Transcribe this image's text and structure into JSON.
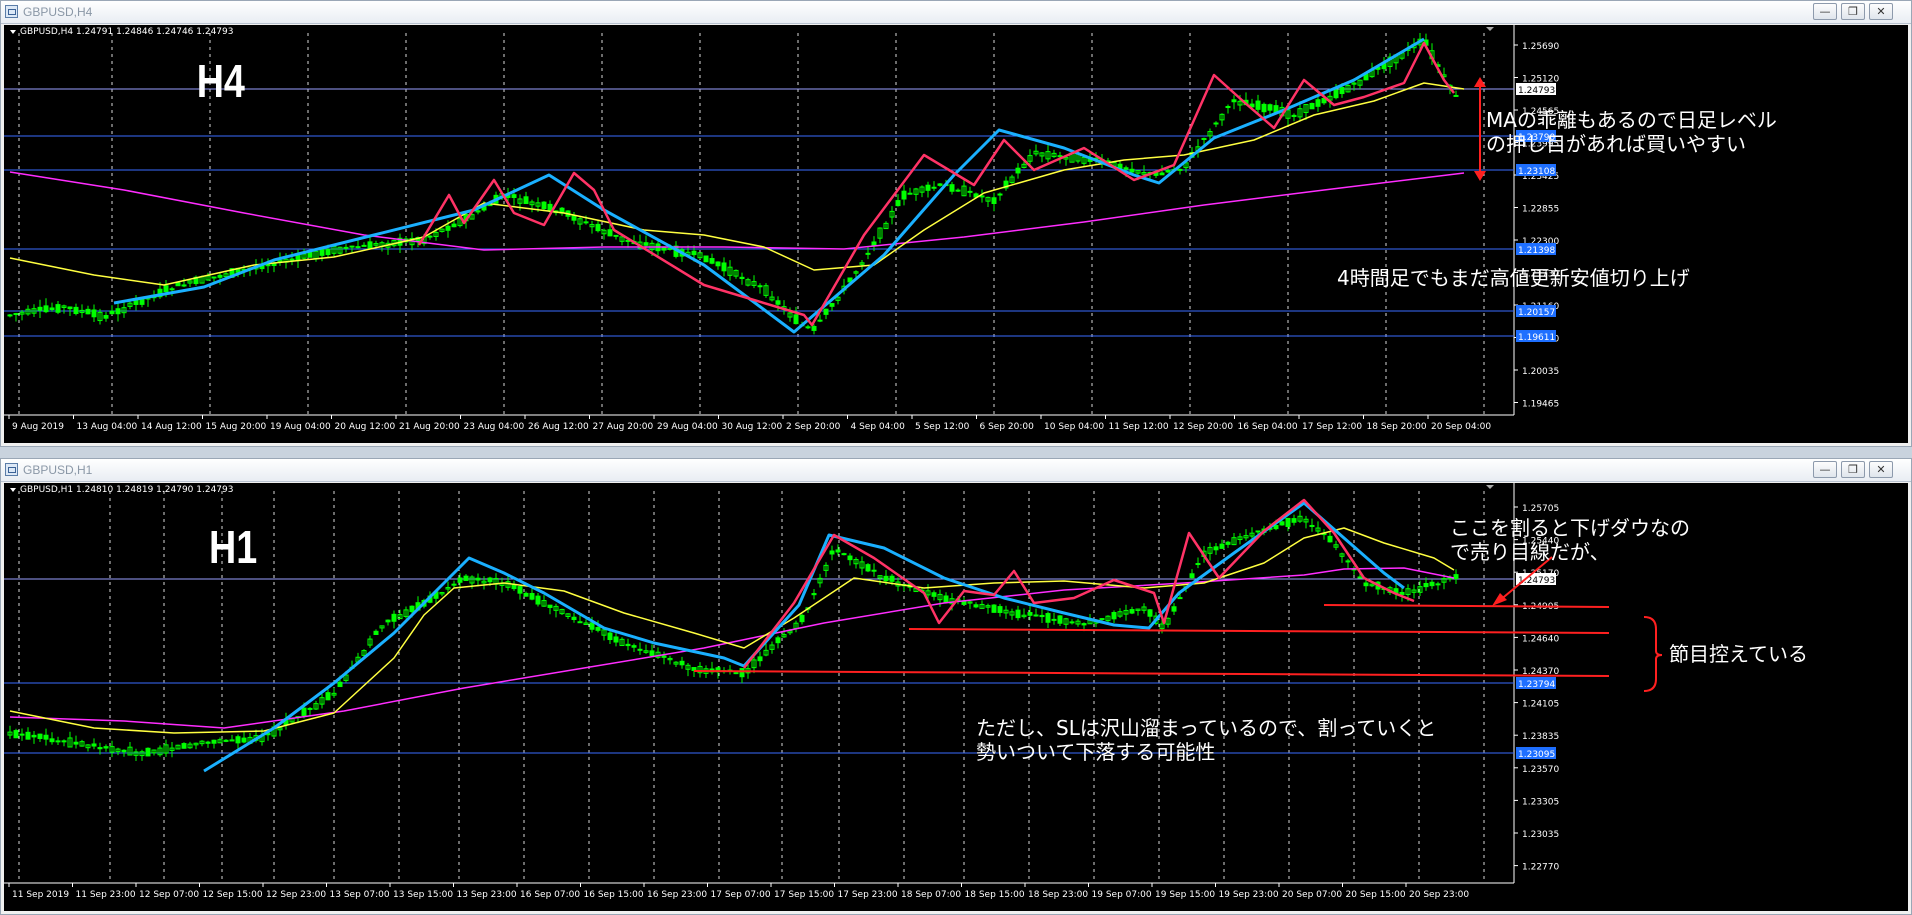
{
  "colors": {
    "bg": "#000000",
    "grid": "#cfcfcf",
    "bull": "#00ff00",
    "bear": "#00ff00",
    "ma_fast": "#ffff40",
    "ma_slow": "#ff2dff",
    "trend_blue": "#1ab0ff",
    "zigzag": "#ff3366",
    "level": "#3a6bff",
    "red": "#ff2020",
    "text": "#ffffff"
  },
  "icons": {
    "window_icon": "chart-window-icon",
    "minimize": "minimize-icon",
    "maximize": "maximize-icon",
    "close": "close-icon"
  },
  "h4": {
    "window_title": "GBPUSD,H4",
    "ohlc": "GBPUSD,H4  1.24791 1.24846 1.24746 1.24793",
    "label": "H4",
    "axis_prices": [
      "1.25690",
      "1.25120",
      "1.24565",
      "1.23995",
      "1.23425",
      "1.22855",
      "1.22300",
      "1.21730",
      "1.21160",
      "1.20590",
      "1.20035",
      "1.19465"
    ],
    "tag_prices": [
      "1.24793",
      "1.23790",
      "1.23108",
      "1.21398",
      "1.20157",
      "1.19611"
    ],
    "time_labels": [
      "9 Aug 2019",
      "13 Aug 04:00",
      "14 Aug 12:00",
      "15 Aug 20:00",
      "19 Aug 04:00",
      "20 Aug 12:00",
      "21 Aug 20:00",
      "23 Aug 04:00",
      "26 Aug 12:00",
      "27 Aug 20:00",
      "29 Aug 04:00",
      "30 Aug 12:00",
      "2 Sep 20:00",
      "4 Sep 04:00",
      "5 Sep 12:00",
      "6 Sep 20:00",
      "10 Sep 04:00",
      "11 Sep 12:00",
      "12 Sep 20:00",
      "16 Sep 04:00",
      "17 Sep 12:00",
      "18 Sep 20:00",
      "20 Sep 04:00"
    ],
    "annotations": [
      "MAの乖離もあるので日足レベル",
      "の押し目があれば買いやすい",
      "4時間足でもまだ高値更新安値切り上げ"
    ]
  },
  "h1": {
    "window_title": "GBPUSD,H1",
    "ohlc": "GBPUSD,H1  1.24810 1.24819 1.24790 1.24793",
    "label": "H1",
    "axis_prices": [
      "1.25705",
      "1.25440",
      "1.25170",
      "1.24905",
      "1.24640",
      "1.24370",
      "1.24105",
      "1.23835",
      "1.23570",
      "1.23305",
      "1.23035",
      "1.22770"
    ],
    "tag_prices": [
      "1.24793",
      "1.23794",
      "1.23095"
    ],
    "time_labels": [
      "11 Sep 2019",
      "11 Sep 23:00",
      "12 Sep 07:00",
      "12 Sep 15:00",
      "12 Sep 23:00",
      "13 Sep 07:00",
      "13 Sep 15:00",
      "13 Sep 23:00",
      "16 Sep 07:00",
      "16 Sep 15:00",
      "16 Sep 23:00",
      "17 Sep 07:00",
      "17 Sep 15:00",
      "17 Sep 23:00",
      "18 Sep 07:00",
      "18 Sep 15:00",
      "18 Sep 23:00",
      "19 Sep 07:00",
      "19 Sep 15:00",
      "19 Sep 23:00",
      "20 Sep 07:00",
      "20 Sep 15:00",
      "20 Sep 23:00"
    ],
    "annotations": [
      "ここを割ると下げダウなの",
      "で売り目線だが、",
      "節目控えている",
      "ただし、SLは沢山溜まっているので、割っていくと",
      "勢いついて下落する可能性"
    ]
  }
}
